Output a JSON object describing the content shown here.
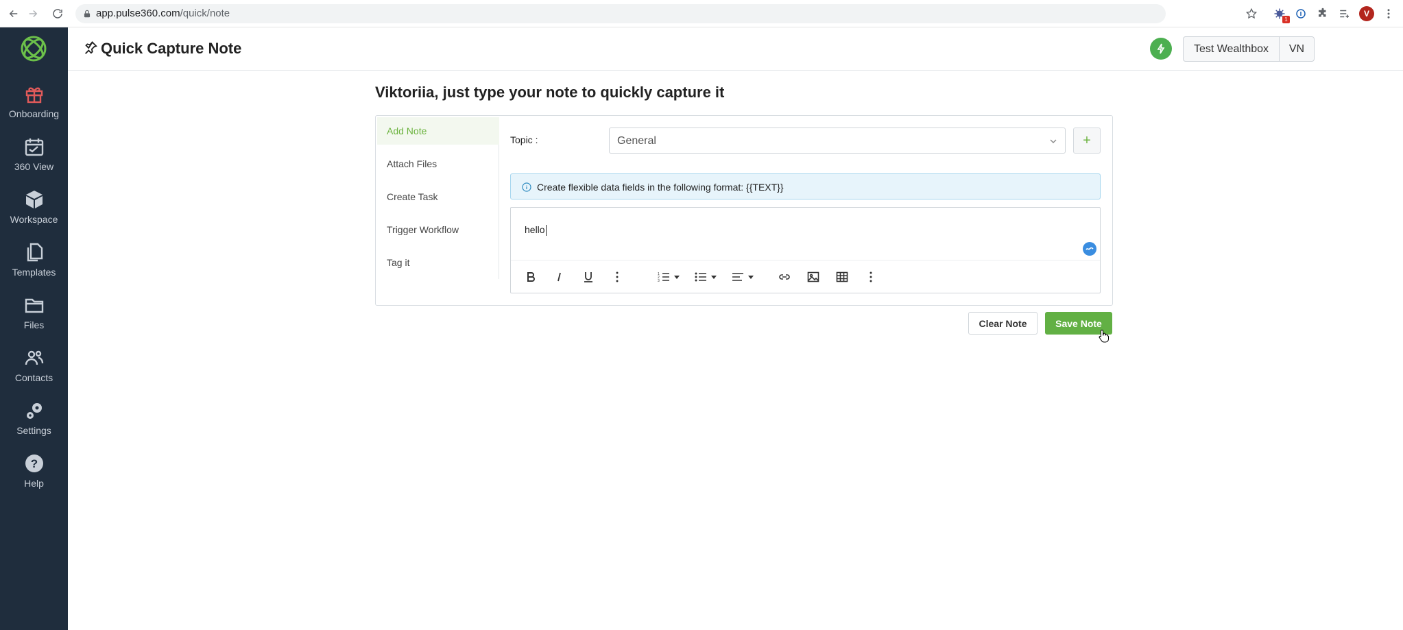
{
  "browser": {
    "url_host": "app.pulse360.com",
    "url_path": "/quick/note",
    "extension_badge": "1",
    "profile_initial": "V"
  },
  "sidebar": {
    "items": [
      {
        "label": "Onboarding",
        "icon": "gift-icon",
        "color": "#e05a5a"
      },
      {
        "label": "360 View",
        "icon": "calendar-icon"
      },
      {
        "label": "Workspace",
        "icon": "cube-icon"
      },
      {
        "label": "Templates",
        "icon": "documents-icon"
      },
      {
        "label": "Files",
        "icon": "folder-icon"
      },
      {
        "label": "Contacts",
        "icon": "people-icon"
      },
      {
        "label": "Settings",
        "icon": "gear-icon"
      },
      {
        "label": "Help",
        "icon": "help-icon"
      }
    ]
  },
  "header": {
    "title": "Quick Capture Note",
    "crm_label": "Test Wealthbox",
    "user_initials": "VN"
  },
  "main": {
    "greeting": "Viktoriia, just type your note to quickly capture it",
    "menu": [
      "Add Note",
      "Attach Files",
      "Create Task",
      "Trigger Workflow",
      "Tag it"
    ],
    "topic_label": "Topic :",
    "topic_value": "General",
    "add_topic_symbol": "+",
    "info_text": "Create flexible data fields in the following format: {{TEXT}}",
    "editor_text": "hello",
    "clear_label": "Clear Note",
    "save_label": "Save Note"
  },
  "colors": {
    "sidebar_bg": "#1f2d3d",
    "accent_green": "#62b044",
    "info_bg": "#e7f4fb"
  }
}
